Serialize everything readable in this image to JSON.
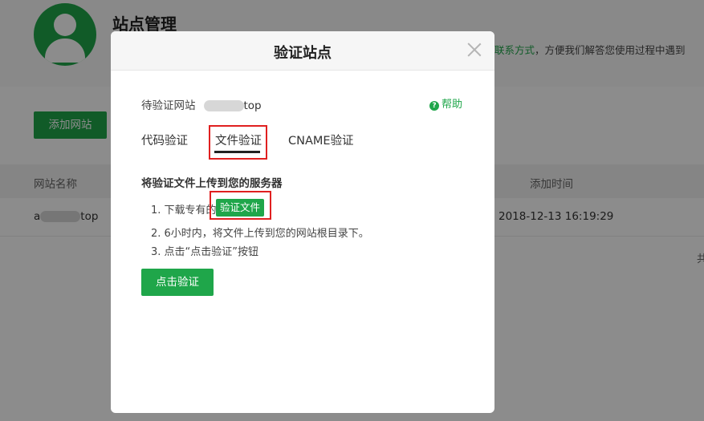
{
  "background": {
    "title": "站点管理",
    "notice_link": "联系方式",
    "notice_text": "，方便我们解答您使用过程中遇到",
    "add_site_button": "添加网站",
    "table": {
      "columns": [
        "网站名称",
        "添加时间"
      ],
      "row": {
        "site_prefix": "a",
        "site_suffix": "top",
        "time": "2018-12-13 16:19:29"
      }
    },
    "edge_char": "共"
  },
  "modal": {
    "title": "验证站点",
    "site_label": "待验证网站",
    "site_suffix": "top",
    "help_label": "帮助",
    "tabs": [
      {
        "label": "代码验证",
        "active": false
      },
      {
        "label": "文件验证",
        "active": true
      },
      {
        "label": "CNAME验证",
        "active": false
      }
    ],
    "section_title": "将验证文件上传到您的服务器",
    "steps": [
      "1. 下载专有的",
      "2. 6小时内，将文件上传到您的网站根目录下。",
      "3. 点击“点击验证”按钮"
    ],
    "download_button": "验证文件",
    "verify_button": "点击验证"
  },
  "colors": {
    "accent": "#1fa64a",
    "highlight_border": "#e02020",
    "overlay": "rgba(0,0,0,0.45)"
  },
  "icons": [
    "user-avatar-icon",
    "close-icon",
    "help-icon"
  ]
}
